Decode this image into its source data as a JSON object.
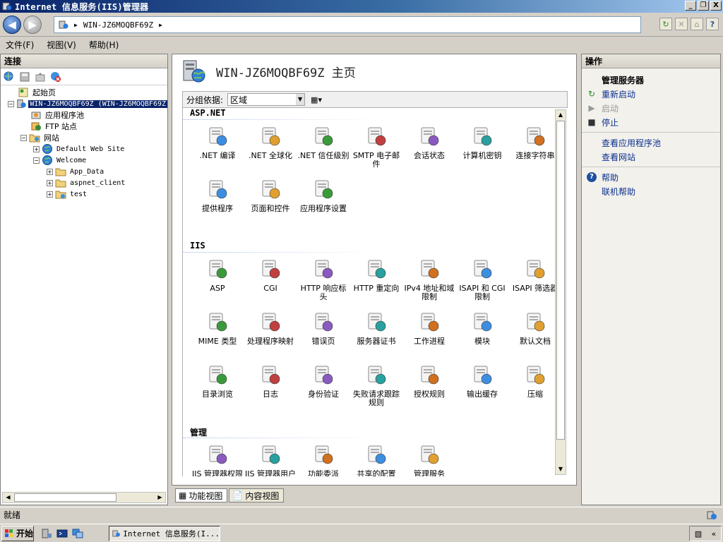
{
  "window": {
    "title": "Internet 信息服务(IIS)管理器",
    "buttons": [
      "_",
      "❐",
      "X"
    ]
  },
  "address": {
    "server": "WIN-JZ6MOQBF69Z",
    "sep1": "▶",
    "sep2": "▶"
  },
  "menu": [
    "文件(F)",
    "视图(V)",
    "帮助(H)"
  ],
  "connections": {
    "header": "连接",
    "tree": [
      {
        "label": "起始页",
        "icon": "start-page-icon",
        "level": 0,
        "expander": ""
      },
      {
        "label": "WIN-JZ6MOQBF69Z (WIN-JZ6MOQBF69Z",
        "icon": "server-icon",
        "level": 0,
        "expander": "−",
        "selected": true
      },
      {
        "label": "应用程序池",
        "icon": "app-pool-icon",
        "level": 1,
        "expander": ""
      },
      {
        "label": "FTP 站点",
        "icon": "ftp-sites-icon",
        "level": 1,
        "expander": ""
      },
      {
        "label": "网站",
        "icon": "websites-folder-icon",
        "level": 1,
        "expander": "−"
      },
      {
        "label": "Default Web Site",
        "icon": "globe-icon",
        "level": 2,
        "expander": "+"
      },
      {
        "label": "Welcome",
        "icon": "globe-icon",
        "level": 2,
        "expander": "−"
      },
      {
        "label": "App_Data",
        "icon": "folder-icon",
        "level": 3,
        "expander": "+"
      },
      {
        "label": "aspnet_client",
        "icon": "folder-icon",
        "level": 3,
        "expander": "+"
      },
      {
        "label": "test",
        "icon": "folder-icon",
        "level": 3,
        "expander": "+"
      }
    ]
  },
  "main": {
    "title": "WIN-JZ6MOQBF69Z 主页",
    "group_by_label": "分组依据:",
    "group_by_value": "区域",
    "sections": [
      {
        "title": "ASP.NET",
        "items": [
          ".NET 编译",
          ".NET 全球化",
          ".NET 信任级别",
          "SMTP 电子邮件",
          "会话状态",
          "计算机密钥",
          "连接字符串",
          "提供程序",
          "页面和控件",
          "应用程序设置"
        ]
      },
      {
        "title": "IIS",
        "items": [
          "ASP",
          "CGI",
          "HTTP 响应标头",
          "HTTP 重定向",
          "IPv4 地址和域限制",
          "ISAPI 和 CGI 限制",
          "ISAPI 筛选器",
          "MIME 类型",
          "处理程序映射",
          "错误页",
          "服务器证书",
          "工作进程",
          "模块",
          "默认文档",
          "目录浏览",
          "日志",
          "身份验证",
          "失败请求跟踪规则",
          "授权规则",
          "输出缓存",
          "压缩"
        ]
      },
      {
        "title": "管理",
        "items": [
          "IIS 管理器权限",
          "IIS 管理器用户",
          "功能委派",
          "共享的配置",
          "管理服务"
        ]
      }
    ],
    "view_tabs": [
      "功能视图",
      "内容视图"
    ]
  },
  "actions": {
    "header": "操作",
    "items": [
      {
        "label": "管理服务器",
        "type": "head",
        "icon": ""
      },
      {
        "label": "重新启动",
        "type": "link",
        "icon": "restart-icon"
      },
      {
        "label": "启动",
        "type": "disabled",
        "icon": "start-icon"
      },
      {
        "label": "停止",
        "type": "link",
        "icon": "stop-icon"
      },
      {
        "label": "",
        "type": "sep"
      },
      {
        "label": "查看应用程序池",
        "type": "link",
        "icon": ""
      },
      {
        "label": "查看网站",
        "type": "link",
        "icon": ""
      },
      {
        "label": "",
        "type": "sep"
      },
      {
        "label": "帮助",
        "type": "link",
        "icon": "help-icon"
      },
      {
        "label": "联机帮助",
        "type": "link",
        "icon": ""
      }
    ]
  },
  "status": {
    "text": "就绪"
  },
  "taskbar": {
    "start": "开始",
    "task": "Internet 信息服务(I..."
  },
  "colors": {
    "title_bar": "#0a246a",
    "link": "#0b2f8f",
    "selection": "#0a246a"
  }
}
